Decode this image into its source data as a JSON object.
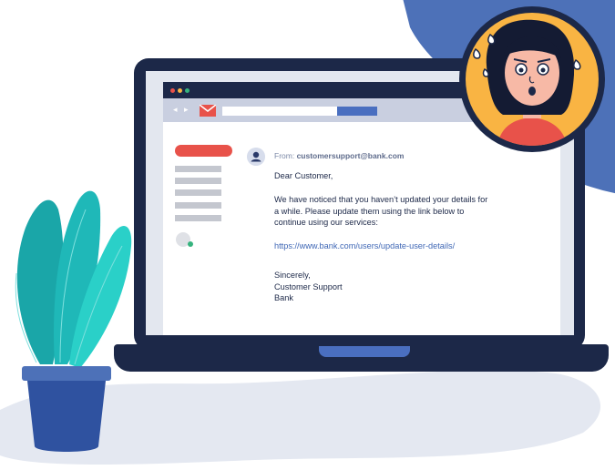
{
  "email": {
    "from_label": "From:",
    "from_address": "customersupport@bank.com",
    "greeting": "Dear Customer,",
    "body_lines": [
      "We have noticed that you haven’t updated your details for",
      "a while. Please update them using the link below to",
      "continue using our services:"
    ],
    "link": "https://www.bank.com/users/update-user-details/",
    "closing": "Sincerely,",
    "signature_lines": [
      "Customer Support",
      "Bank"
    ]
  },
  "colors": {
    "navy": "#1c2848",
    "accent_blue": "#4a6fc0",
    "alert_red": "#e8524a",
    "face_yellow": "#f9b443",
    "plant_teal": "#1fb8b8"
  },
  "icons": [
    "mail-icon",
    "user-avatar-icon",
    "chevron-left-icon",
    "chevron-right-icon"
  ]
}
